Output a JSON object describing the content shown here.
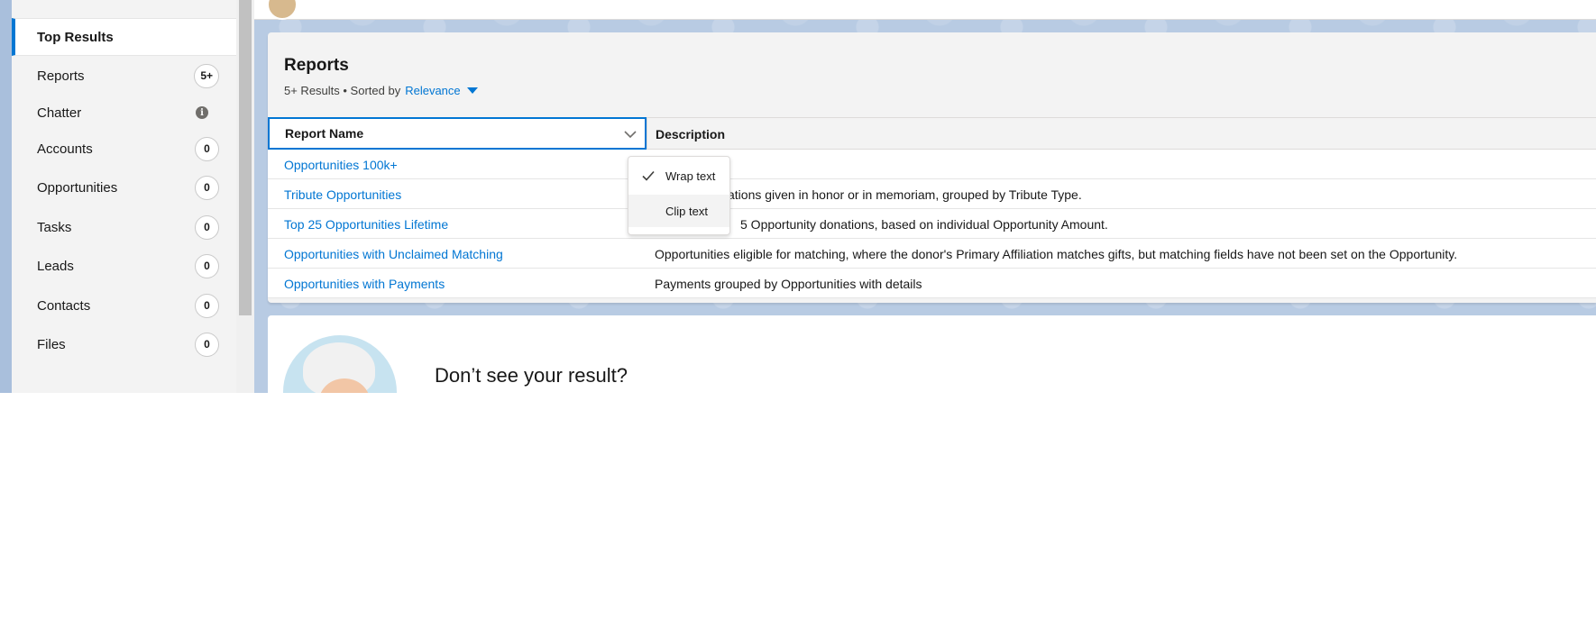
{
  "sidebar": {
    "items": [
      {
        "label": "Top Results",
        "badge": ""
      },
      {
        "label": "Reports",
        "badge": "5+"
      },
      {
        "label": "Chatter",
        "badge": "i"
      },
      {
        "label": "Accounts",
        "badge": "0"
      },
      {
        "label": "Opportunities",
        "badge": "0"
      },
      {
        "label": "Tasks",
        "badge": "0"
      },
      {
        "label": "Leads",
        "badge": "0"
      },
      {
        "label": "Contacts",
        "badge": "0"
      },
      {
        "label": "Files",
        "badge": "0"
      }
    ]
  },
  "results": {
    "title": "Reports",
    "count_text": "5+ Results • Sorted by",
    "sort_value": "Relevance",
    "columns": {
      "name": "Report Name",
      "description": "Description"
    },
    "rows": [
      {
        "name": "Opportunities 100k+",
        "description": ""
      },
      {
        "name": "Tribute Opportunities",
        "description": "ations given in honor or in memoriam, grouped by Tribute Type."
      },
      {
        "name": "Top 25 Opportunities Lifetime",
        "description": "5 Opportunity donations, based on individual Opportunity Amount."
      },
      {
        "name": "Opportunities with Unclaimed Matching",
        "description": "Opportunities eligible for matching, where the donor's Primary Affiliation matches gifts, but matching fields have not been set on the Opportunity."
      },
      {
        "name": "Opportunities with Payments",
        "description": "Payments grouped by Opportunities with details"
      }
    ]
  },
  "column_menu": {
    "items": [
      {
        "label": "Wrap text",
        "checked": true
      },
      {
        "label": "Clip text",
        "checked": false
      }
    ]
  },
  "empty_state": {
    "title": "Don’t see your result?"
  },
  "colors": {
    "accent": "#0176d3",
    "background": "#b8cbe3"
  }
}
